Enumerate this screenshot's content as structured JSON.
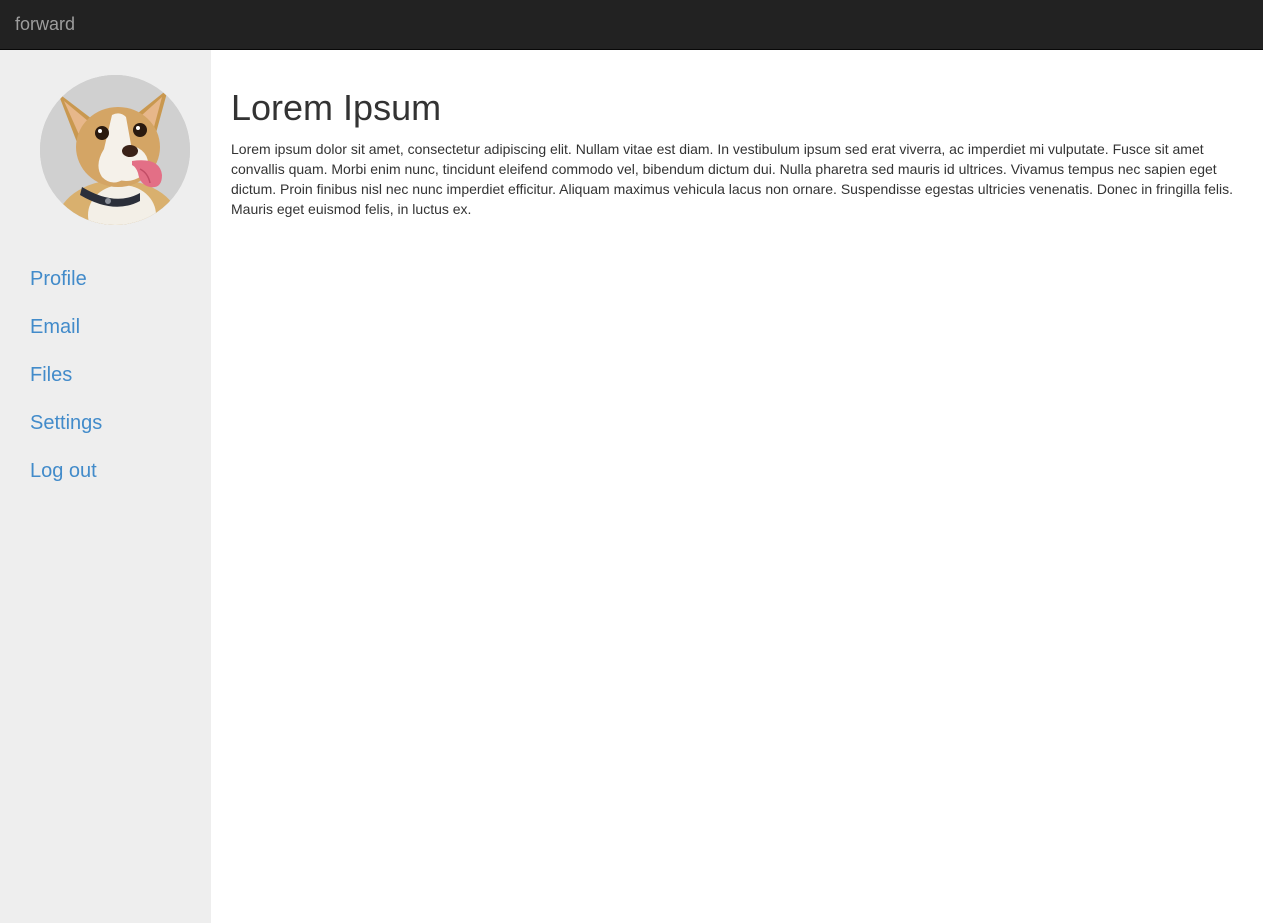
{
  "navbar": {
    "brand": "forward"
  },
  "sidebar": {
    "avatar_alt": "chihuahua dog avatar",
    "items": [
      {
        "label": "Profile"
      },
      {
        "label": "Email"
      },
      {
        "label": "Files"
      },
      {
        "label": "Settings"
      },
      {
        "label": "Log out"
      }
    ]
  },
  "main": {
    "title": "Lorem Ipsum",
    "body": "Lorem ipsum dolor sit amet, consectetur adipiscing elit. Nullam vitae est diam. In vestibulum ipsum sed erat viverra, ac imperdiet mi vulputate. Fusce sit amet convallis quam. Morbi enim nunc, tincidunt eleifend commodo vel, bibendum dictum dui. Nulla pharetra sed mauris id ultrices. Vivamus tempus nec sapien eget dictum. Proin finibus nisl nec nunc imperdiet efficitur. Aliquam maximus vehicula lacus non ornare. Suspendisse egestas ultricies venenatis. Donec in fringilla felis. Mauris eget euismod felis, in luctus ex."
  },
  "colors": {
    "navbar_bg": "#222222",
    "brand_text": "#9d9d9d",
    "sidebar_bg": "#eeeeee",
    "link": "#428bca",
    "text": "#333333"
  }
}
